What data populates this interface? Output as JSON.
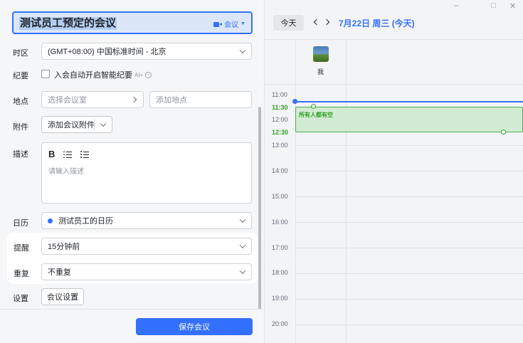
{
  "event": {
    "title": "测试员工预定的会议",
    "type_label": "会议"
  },
  "form": {
    "timezone": {
      "label": "时区",
      "value": "(GMT+08:00) 中国标准时间 - 北京"
    },
    "minutes": {
      "label": "纪要",
      "checkbox_label": "入会自动开启智能纪要",
      "ai_tag": "AI+",
      "info": "i"
    },
    "location": {
      "label": "地点",
      "room_placeholder": "选择会议室",
      "address_placeholder": "添加地点"
    },
    "attachment": {
      "label": "附件",
      "button": "添加会议附件"
    },
    "description": {
      "label": "描述",
      "bold": "B",
      "placeholder": "请输入描述"
    },
    "calendar": {
      "label": "日历",
      "value": "测试员工的日历",
      "dot_color": "#3370ff"
    },
    "reminder": {
      "label": "提醒",
      "value": "15分钟前"
    },
    "repeat": {
      "label": "重复",
      "value": "不重复"
    },
    "settings": {
      "label": "设置",
      "button": "会议设置"
    },
    "save_button": "保存会议"
  },
  "calendar_view": {
    "window_controls": {
      "minimize": "–",
      "maximize": "□",
      "close": "✕"
    },
    "today_button": "今天",
    "date_title": "7月22日 周三 (今天)",
    "attendee": "我",
    "times": [
      "11:00",
      "11:30",
      "12:00",
      "12:30",
      "13:00",
      "14:00",
      "15:00",
      "16:00",
      "17:00",
      "18:00",
      "19:00",
      "20:00"
    ],
    "free_slot_label": "所有人都有空",
    "accent": "#3370ff",
    "free_color": "#2ea121"
  }
}
